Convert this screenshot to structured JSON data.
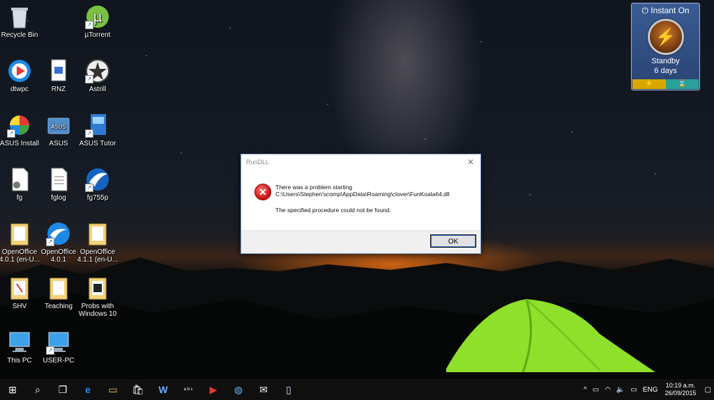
{
  "desktop_icons": [
    {
      "label": "Recycle Bin",
      "icon": "recycle-bin-icon"
    },
    {
      "label": "µTorrent",
      "icon": "utorrent-icon"
    },
    {
      "label": "dtwpc",
      "icon": "dtwpc-icon"
    },
    {
      "label": "RNZ",
      "icon": "rnz-icon"
    },
    {
      "label": "Astrill",
      "icon": "astrill-icon"
    },
    {
      "label": "ASUS Install",
      "icon": "asus-install-icon"
    },
    {
      "label": "ASUS",
      "icon": "asus-icon"
    },
    {
      "label": "ASUS Tutor",
      "icon": "asus-tutor-icon"
    },
    {
      "label": "fg",
      "icon": "file-icon"
    },
    {
      "label": "fglog",
      "icon": "text-file-icon"
    },
    {
      "label": "fg755p",
      "icon": "fg755p-icon"
    },
    {
      "label": "OpenOffice 4.0.1 (en-U...",
      "icon": "folder-icon"
    },
    {
      "label": "OpenOffice 4.0.1",
      "icon": "openoffice-icon"
    },
    {
      "label": "OpenOffice 4.1.1 (en-U...",
      "icon": "folder-icon"
    },
    {
      "label": "SHV",
      "icon": "pdf-icon"
    },
    {
      "label": "Teaching",
      "icon": "folder-icon"
    },
    {
      "label": "Probs with Windows 10",
      "icon": "folder-icon"
    },
    {
      "label": "This PC",
      "icon": "computer-icon"
    },
    {
      "label": "USER-PC",
      "icon": "computer-icon"
    }
  ],
  "gadget": {
    "title": "Instant On",
    "status": "Standby",
    "days": "6 days",
    "power_glyph": "⚡",
    "bar_left_glyph": "⚡",
    "bar_right_glyph": "⌛",
    "colors": {
      "bar_left": "#d8a800",
      "bar_right": "#2aa198"
    }
  },
  "dialog": {
    "title": "RunDLL",
    "close_glyph": "✕",
    "line1": "There was a problem starting",
    "line2": "C:\\Users\\Stephen'scomp\\AppData\\Roaming\\clover\\FunKoala64.dll",
    "line3": "The specified procedure could not be found.",
    "ok_label": "OK",
    "error_glyph": "✕"
  },
  "taskbar": {
    "items": [
      {
        "icon": "windows-start-icon",
        "glyph": "⊞"
      },
      {
        "icon": "search-icon",
        "glyph": "⌕"
      },
      {
        "icon": "task-view-icon",
        "glyph": "❐"
      },
      {
        "icon": "edge-icon",
        "glyph": "e"
      },
      {
        "icon": "file-explorer-icon",
        "glyph": "▭"
      },
      {
        "icon": "store-icon",
        "glyph": "🛍"
      },
      {
        "icon": "word-icon",
        "glyph": "W"
      },
      {
        "icon": "abc-icon",
        "glyph": "a b c"
      },
      {
        "icon": "media-player-icon",
        "glyph": "▶"
      },
      {
        "icon": "globe-icon",
        "glyph": "◍"
      },
      {
        "icon": "mail-icon",
        "glyph": "✉"
      },
      {
        "icon": "document-icon",
        "glyph": "▯"
      }
    ],
    "tray": {
      "chevron": "^",
      "battery_glyph": "▭",
      "wifi_glyph": "◠",
      "volume_glyph": "🔈",
      "message_glyph": "▭",
      "language": "ENG",
      "time": "10:19 a.m.",
      "date": "26/09/2015",
      "notification_glyph": "▢"
    }
  },
  "colors": {
    "accent": "#1e90ff",
    "error": "#c80f0f"
  }
}
